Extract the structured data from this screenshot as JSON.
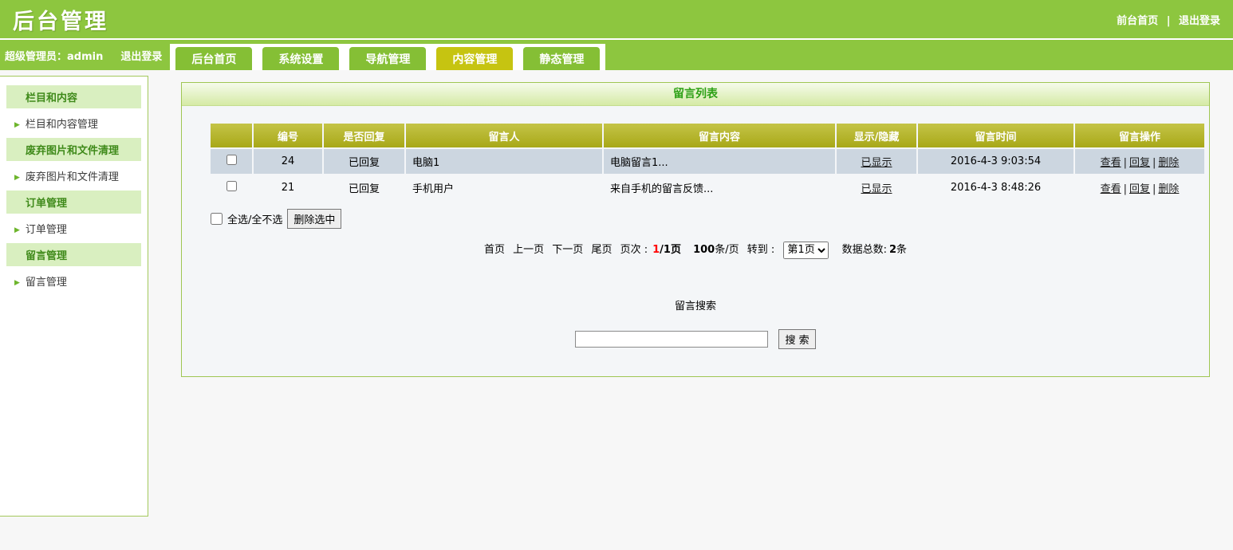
{
  "sep": "|",
  "header": {
    "title": "后台管理",
    "frontend_link": "前台首页",
    "logout_link": "退出登录"
  },
  "nav": {
    "account": "超级管理员：admin",
    "logout": "退出登录"
  },
  "tabs": [
    {
      "label": "后台首页",
      "active": false
    },
    {
      "label": "系统设置",
      "active": false
    },
    {
      "label": "导航管理",
      "active": false
    },
    {
      "label": "内容管理",
      "active": true
    },
    {
      "label": "静态管理",
      "active": false
    }
  ],
  "sidebar": {
    "sections": [
      {
        "title": "栏目和内容",
        "items": [
          "栏目和内容管理"
        ]
      },
      {
        "title": "废弃图片和文件清理",
        "items": [
          "废弃图片和文件清理"
        ]
      },
      {
        "title": "订单管理",
        "items": [
          "订单管理"
        ]
      },
      {
        "title": "留言管理",
        "items": [
          "留言管理"
        ]
      }
    ]
  },
  "panel": {
    "title": "留言列表",
    "table": {
      "headers": [
        "",
        "编号",
        "是否回复",
        "留言人",
        "留言内容",
        "显示/隐藏",
        "留言时间",
        "留言操作"
      ],
      "rows": [
        {
          "id": "24",
          "replied": "已回复",
          "author": "电脑1",
          "content": "电脑留言1...",
          "visibility": "已显示",
          "time": "2016-4-3 9:03:54",
          "actions": [
            "查看",
            "回复",
            "删除"
          ]
        },
        {
          "id": "21",
          "replied": "已回复",
          "author": "手机用户",
          "content": "来自手机的留言反馈...",
          "visibility": "已显示",
          "time": "2016-4-3 8:48:26",
          "actions": [
            "查看",
            "回复",
            "删除"
          ]
        }
      ]
    },
    "bulk": {
      "select_all_label": "全选/全不选",
      "delete_button": "删除选中"
    },
    "pagination": {
      "first": "首页",
      "prev": "上一页",
      "next": "下一页",
      "last": "尾页",
      "page_label": "页次 :",
      "current_page": "1",
      "pages_suffix": "/1页",
      "per_page_num": "100",
      "per_page_suffix": "条/页",
      "goto_label": "转到 :",
      "goto_value": "第1页",
      "total_label": "数据总数:",
      "total_count": "2",
      "total_suffix": "条"
    },
    "search": {
      "title": "留言搜索",
      "button": "搜 索"
    }
  },
  "colors": {
    "brand_green": "#8dc63f",
    "active_tab_yellow": "#c6c411",
    "table_header_olive": "#b3b327",
    "row_highlight_blue": "#ccd6e0",
    "panel_border_green": "#9fc653",
    "panel_title_green": "#2ca015",
    "current_page_red": "#ff0000"
  }
}
